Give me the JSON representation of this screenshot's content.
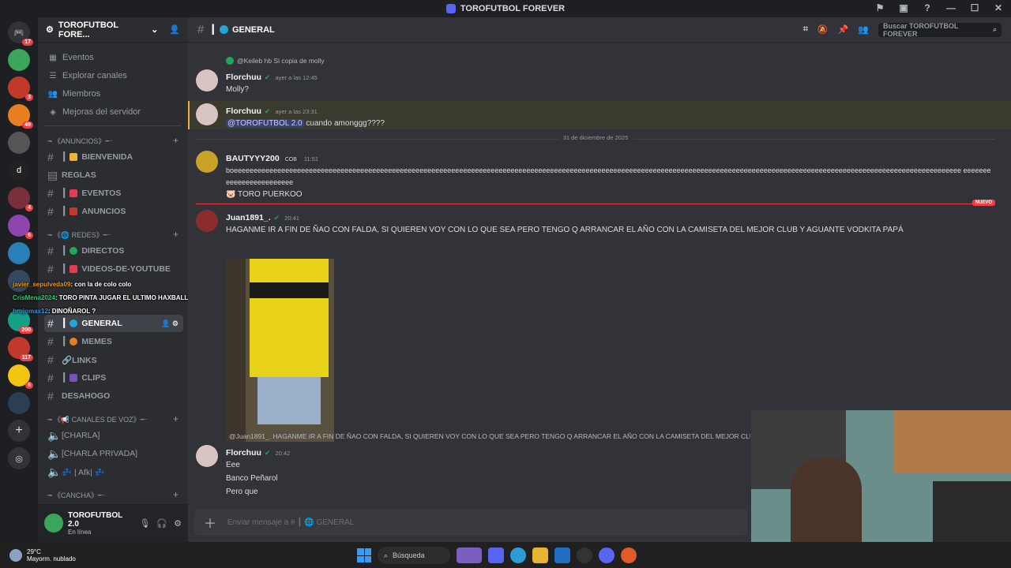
{
  "window": {
    "title": "TOROFUTBOL FOREVER"
  },
  "titlebar_icons": [
    "inbox-icon",
    "monitor-icon",
    "help-icon",
    "minimize-icon",
    "maximize-icon",
    "close-icon"
  ],
  "server_badges": [
    "17",
    "3",
    "49",
    "4",
    "6",
    "200",
    "117",
    "6"
  ],
  "server_letter": "d",
  "sidebar": {
    "server_name": "TOROFUTBOL FORE...",
    "nav": [
      {
        "label": "Eventos",
        "icon": "calendar-icon"
      },
      {
        "label": "Explorar canales",
        "icon": "compass-icon"
      },
      {
        "label": "Miembros",
        "icon": "members-icon"
      },
      {
        "label": "Mejoras del servidor",
        "icon": "boost-icon"
      }
    ],
    "cat_anuncios": "╼ 《ANUNCIOS》╾",
    "ch_bienvenida": "BIENVENIDA",
    "ch_reglas": "REGLAS",
    "ch_eventos": "EVENTOS",
    "ch_anuncios": "ANUNCIOS",
    "cat_redes": "╼ 《🌐 REDES》╾",
    "ch_directos": "DIRECTOS",
    "ch_videos": "VIDEOS-DE-YOUTUBE",
    "ch_general": "GENERAL",
    "ch_memes": "MEMES",
    "ch_links": "🔗LINKS",
    "ch_clips": "CLIPS",
    "ch_desahogo": "DESAHOGO",
    "cat_voz": "╼ 《📢 CANALES DE VOZ》╾",
    "vc_charla": "[CHARLA]",
    "vc_privada": "[CHARLA PRIVADA]",
    "vc_afk": "💤 | Afk| 💤",
    "cat_cancha": "╼ 《CANCHA》╾"
  },
  "user": {
    "name": "TOROFUTBOL 2.0",
    "status": "En línea"
  },
  "header": {
    "channel": "GENERAL",
    "search_placeholder": "Buscar TOROFUTBOL FOREVER"
  },
  "messages": {
    "reply1": "@Keileb hb Si copia de molly",
    "m1_author": "Florchuu",
    "m1_time": "ayer a las 12:45",
    "m1_text": "Molly?",
    "m2_author": "Florchuu",
    "m2_time": "ayer a las 23:31",
    "m2_mention": "@TOROFUTBOL 2.0",
    "m2_text": " cuando amonggg????",
    "date_divider": "31 de diciembre de 2025",
    "m3_author": "BAUTYYY200",
    "m3_tag": "COB",
    "m3_time": "11:51",
    "m3_text": "boeeeeeeeeeeeeeeeeeeeeeeeeeeeeeeeeeeeeeeeeeeeeeeeeeeeeeeeeeeeeeeeeeeeeeeeeeeeeeeeeeeeeeeeeeeeeeeeeeeeeeeeeeeeeeeeeeeeeeeeeeeeeeeeeeeeeeeeeeeeeeeeeeeeeeeeeeeeeeeeeeeeeeeeeeeeeeeeeeeeeeeee eeeeeeeeeeeeeeeeeeeeeeee",
    "m3_text2": "🐷 TORO PUERKOO",
    "new_label": "NUEVO",
    "m4_author": "Juan1891_.",
    "m4_time": "20:41",
    "m4_text": "HAGANME IR A FIN DE ÑAO CON FALDA, SI QUIEREN VOY CON LO QUE SEA PERO TENGO Q ARRANCAR EL AÑO CON LA CAMISETA DEL MEJOR CLUB Y AGUANTE VODKITA PAPÁ",
    "reply2": "@Juan1891_. HAGANME IR A FIN DE ÑAO CON FALDA, SI QUIEREN VOY CON LO QUE SEA PERO TENGO Q ARRANCAR EL AÑO CON LA CAMISETA DEL MEJOR CLUB",
    "m5_author": "Florchuu",
    "m5_time": "20:42",
    "m5_lines": [
      "Eee",
      "Banco Peñarol",
      "Pero que"
    ]
  },
  "composer": {
    "placeholder": "Enviar mensaje a #  ┃ 🌐 GENERAL"
  },
  "stream_chat": [
    {
      "user": "javier_sepulveda09",
      "text": ": con la de colo colo"
    },
    {
      "user": "CrisMena2024",
      "text": ": TORO PINTA JUGAR EL ULTIMO HAXBALL DEL AÑO?"
    },
    {
      "user": "brujomax12",
      "text": ": DINOÑAROL ?"
    }
  ],
  "taskbar": {
    "temp": "29°C",
    "weather": "Mayorm. nublado",
    "search": "Búsqueda"
  },
  "colors": {
    "accent": "#5865f2",
    "online": "#23a55a",
    "new": "#f23f43",
    "mention_bg": "#3c4270"
  }
}
